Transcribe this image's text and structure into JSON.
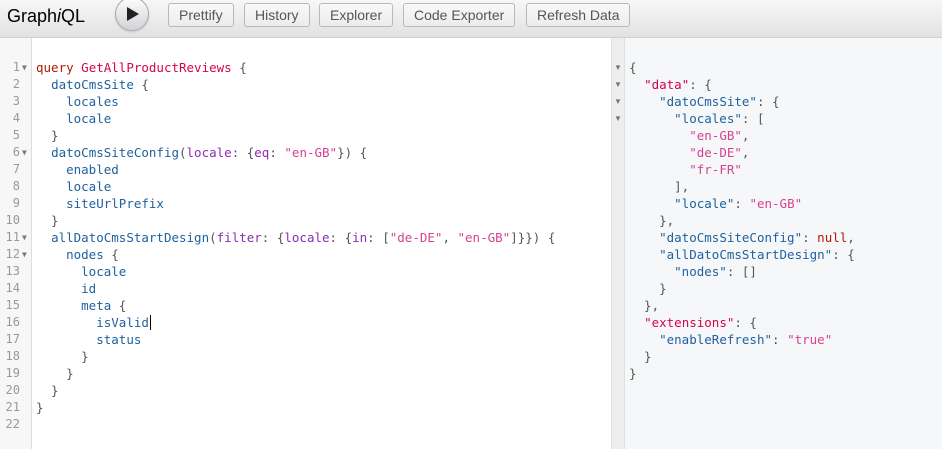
{
  "app": {
    "logo_prefix": "Graph",
    "logo_italic": "i",
    "logo_suffix": "QL"
  },
  "toolbar": {
    "run_icon": "play-icon",
    "buttons": [
      "Prettify",
      "History",
      "Explorer",
      "Code Exporter",
      "Refresh Data"
    ]
  },
  "editor": {
    "line_numbers": [
      "1",
      "2",
      "3",
      "4",
      "5",
      "6",
      "7",
      "8",
      "9",
      "10",
      "11",
      "12",
      "13",
      "14",
      "15",
      "16",
      "17",
      "18",
      "19",
      "20",
      "21",
      "22"
    ],
    "lines": [
      [
        [
          "kw",
          "query"
        ],
        [
          "punc",
          " "
        ],
        [
          "def",
          "GetAllProductReviews"
        ],
        [
          "punc",
          " {"
        ]
      ],
      [
        [
          "punc",
          "  "
        ],
        [
          "prop",
          "datoCmsSite"
        ],
        [
          "punc",
          " {"
        ]
      ],
      [
        [
          "punc",
          "    "
        ],
        [
          "prop",
          "locales"
        ]
      ],
      [
        [
          "punc",
          "    "
        ],
        [
          "prop",
          "locale"
        ]
      ],
      [
        [
          "punc",
          "  }"
        ]
      ],
      [
        [
          "punc",
          "  "
        ],
        [
          "prop",
          "datoCmsSiteConfig"
        ],
        [
          "punc",
          "("
        ],
        [
          "attr",
          "locale"
        ],
        [
          "punc",
          ": {"
        ],
        [
          "attr",
          "eq"
        ],
        [
          "punc",
          ": "
        ],
        [
          "str",
          "\"en-GB\""
        ],
        [
          "punc",
          "}) {"
        ]
      ],
      [
        [
          "punc",
          "    "
        ],
        [
          "prop",
          "enabled"
        ]
      ],
      [
        [
          "punc",
          "    "
        ],
        [
          "prop",
          "locale"
        ]
      ],
      [
        [
          "punc",
          "    "
        ],
        [
          "prop",
          "siteUrlPrefix"
        ]
      ],
      [
        [
          "punc",
          "  }"
        ]
      ],
      [
        [
          "punc",
          "  "
        ],
        [
          "prop",
          "allDatoCmsStartDesign"
        ],
        [
          "punc",
          "("
        ],
        [
          "attr",
          "filter"
        ],
        [
          "punc",
          ": {"
        ],
        [
          "attr",
          "locale"
        ],
        [
          "punc",
          ": {"
        ],
        [
          "attr",
          "in"
        ],
        [
          "punc",
          ": ["
        ],
        [
          "str",
          "\"de-DE\""
        ],
        [
          "punc",
          ", "
        ],
        [
          "str",
          "\"en-GB\""
        ],
        [
          "punc",
          "]}}) {"
        ]
      ],
      [
        [
          "punc",
          "    "
        ],
        [
          "prop",
          "nodes"
        ],
        [
          "punc",
          " {"
        ]
      ],
      [
        [
          "punc",
          "      "
        ],
        [
          "prop",
          "locale"
        ]
      ],
      [
        [
          "punc",
          "      "
        ],
        [
          "prop",
          "id"
        ]
      ],
      [
        [
          "punc",
          "      "
        ],
        [
          "prop",
          "meta"
        ],
        [
          "punc",
          " {"
        ]
      ],
      [
        [
          "punc",
          "        "
        ],
        [
          "prop",
          "isValid"
        ]
      ],
      [
        [
          "punc",
          "        "
        ],
        [
          "prop",
          "status"
        ]
      ],
      [
        [
          "punc",
          "      }"
        ]
      ],
      [
        [
          "punc",
          "    }"
        ]
      ],
      [
        [
          "punc",
          "  }"
        ]
      ],
      [
        [
          "punc",
          "}"
        ]
      ],
      []
    ],
    "fold_lines": [
      1,
      6,
      11,
      12
    ]
  },
  "result": {
    "lines": [
      [
        [
          "punc",
          "{"
        ]
      ],
      [
        [
          "punc",
          "  "
        ],
        [
          "rkey0",
          "\"data\""
        ],
        [
          "punc",
          ": {"
        ]
      ],
      [
        [
          "punc",
          "    "
        ],
        [
          "key",
          "\"datoCmsSite\""
        ],
        [
          "punc",
          ": {"
        ]
      ],
      [
        [
          "punc",
          "      "
        ],
        [
          "key",
          "\"locales\""
        ],
        [
          "punc",
          ": ["
        ]
      ],
      [
        [
          "punc",
          "        "
        ],
        [
          "str",
          "\"en-GB\""
        ],
        [
          "punc",
          ","
        ]
      ],
      [
        [
          "punc",
          "        "
        ],
        [
          "str",
          "\"de-DE\""
        ],
        [
          "punc",
          ","
        ]
      ],
      [
        [
          "punc",
          "        "
        ],
        [
          "str",
          "\"fr-FR\""
        ]
      ],
      [
        [
          "punc",
          "      ],"
        ]
      ],
      [
        [
          "punc",
          "      "
        ],
        [
          "key",
          "\"locale\""
        ],
        [
          "punc",
          ": "
        ],
        [
          "str",
          "\"en-GB\""
        ]
      ],
      [
        [
          "punc",
          "    },"
        ]
      ],
      [
        [
          "punc",
          "    "
        ],
        [
          "key",
          "\"datoCmsSiteConfig\""
        ],
        [
          "punc",
          ": "
        ],
        [
          "null",
          "null"
        ],
        [
          "punc",
          ","
        ]
      ],
      [
        [
          "punc",
          "    "
        ],
        [
          "key",
          "\"allDatoCmsStartDesign\""
        ],
        [
          "punc",
          ": {"
        ]
      ],
      [
        [
          "punc",
          "      "
        ],
        [
          "key",
          "\"nodes\""
        ],
        [
          "punc",
          ": []"
        ]
      ],
      [
        [
          "punc",
          "    }"
        ]
      ],
      [
        [
          "punc",
          "  },"
        ]
      ],
      [
        [
          "punc",
          "  "
        ],
        [
          "rkey0",
          "\"extensions\""
        ],
        [
          "punc",
          ": {"
        ]
      ],
      [
        [
          "punc",
          "    "
        ],
        [
          "key",
          "\"enableRefresh\""
        ],
        [
          "punc",
          ": "
        ],
        [
          "str",
          "\"true\""
        ]
      ],
      [
        [
          "punc",
          "  }"
        ]
      ],
      [
        [
          "punc",
          "}"
        ]
      ]
    ],
    "fold_lines": [
      1,
      2,
      3,
      4
    ]
  }
}
